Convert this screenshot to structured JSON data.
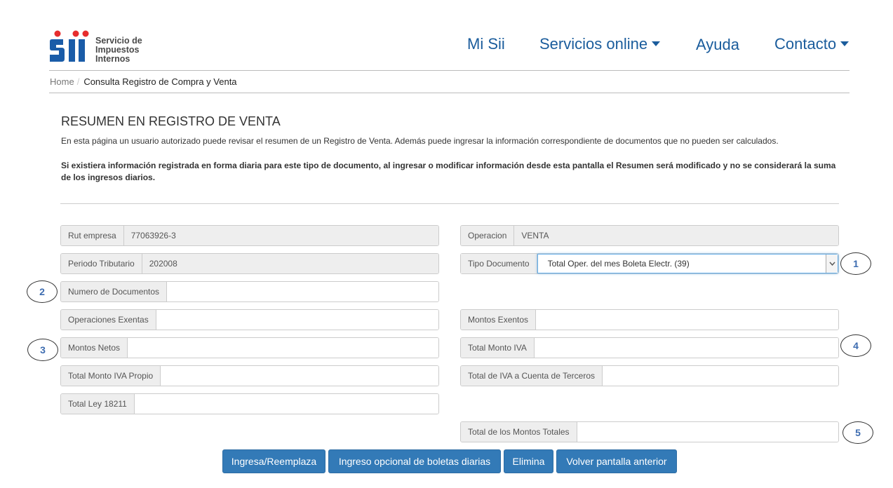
{
  "header": {
    "logo_lines": [
      "Servicio de",
      "Impuestos",
      "Internos"
    ],
    "nav": [
      {
        "label": "Mi Sii",
        "has_caret": false
      },
      {
        "label": "Servicios online",
        "has_caret": true
      },
      {
        "label": "Ayuda",
        "has_caret": false
      },
      {
        "label": "Contacto",
        "has_caret": true
      }
    ]
  },
  "breadcrumb": {
    "home": "Home",
    "separator": "/",
    "current": "Consulta Registro de Compra y Venta"
  },
  "page": {
    "title": "RESUMEN EN REGISTRO DE VENTA",
    "description": "En esta página un usuario autorizado puede revisar el resumen de un Registro de Venta. Además puede ingresar la información correspondiente de documentos que no pueden ser calculados.",
    "warning": "Si existiera información registrada en forma diaria para este tipo de documento, al ingresar o modificar información desde esta pantalla el Resumen será modificado y no se considerará la suma de los ingresos diarios."
  },
  "form": {
    "rut_empresa": {
      "label": "Rut empresa",
      "value": "77063926-3"
    },
    "operacion": {
      "label": "Operacion",
      "value": "VENTA"
    },
    "periodo_tributario": {
      "label": "Periodo Tributario",
      "value": "202008"
    },
    "tipo_documento": {
      "label": "Tipo Documento",
      "value": "Total Oper. del mes Boleta Electr. (39)"
    },
    "numero_documentos": {
      "label": "Numero de Documentos",
      "value": ""
    },
    "operaciones_exentas": {
      "label": "Operaciones Exentas",
      "value": ""
    },
    "montos_exentos": {
      "label": "Montos Exentos",
      "value": ""
    },
    "montos_netos": {
      "label": "Montos Netos",
      "value": ""
    },
    "total_monto_iva": {
      "label": "Total Monto IVA",
      "value": ""
    },
    "total_monto_iva_propio": {
      "label": "Total Monto IVA Propio",
      "value": ""
    },
    "total_iva_terceros": {
      "label": "Total de IVA a Cuenta de Terceros",
      "value": ""
    },
    "total_ley_18211": {
      "label": "Total Ley 18211",
      "value": ""
    },
    "total_montos_totales": {
      "label": "Total de los Montos Totales",
      "value": ""
    }
  },
  "annotations": [
    "1",
    "2",
    "3",
    "4",
    "5"
  ],
  "buttons": {
    "ingresa": "Ingresa/Reemplaza",
    "boletas": "Ingreso opcional de boletas diarias",
    "elimina": "Elimina",
    "volver": "Volver pantalla anterior"
  },
  "colors": {
    "brand_blue": "#1a5c9c",
    "button_blue": "#337ab7",
    "logo_red": "#e62d2e",
    "logo_blue": "#1a5ca8"
  }
}
